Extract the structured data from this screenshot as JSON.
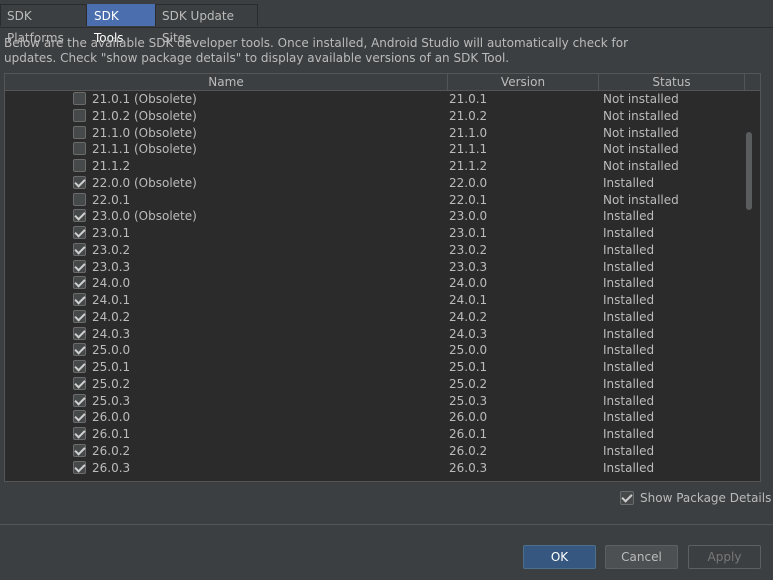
{
  "tabs": [
    {
      "label": "SDK Platforms"
    },
    {
      "label": "SDK Tools"
    },
    {
      "label": "SDK Update Sites"
    }
  ],
  "description_line1": "Below are the available SDK developer tools. Once installed, Android Studio will automatically check for",
  "description_line2": "updates. Check \"show package details\" to display available versions of an SDK Tool.",
  "table": {
    "columns": {
      "name": "Name",
      "version": "Version",
      "status": "Status"
    },
    "rows": [
      {
        "name": "21.0.1 (Obsolete)",
        "version": "21.0.1",
        "status": "Not installed",
        "checked": false
      },
      {
        "name": "21.0.2 (Obsolete)",
        "version": "21.0.2",
        "status": "Not installed",
        "checked": false
      },
      {
        "name": "21.1.0 (Obsolete)",
        "version": "21.1.0",
        "status": "Not installed",
        "checked": false
      },
      {
        "name": "21.1.1 (Obsolete)",
        "version": "21.1.1",
        "status": "Not installed",
        "checked": false
      },
      {
        "name": "21.1.2",
        "version": "21.1.2",
        "status": "Not installed",
        "checked": false
      },
      {
        "name": "22.0.0 (Obsolete)",
        "version": "22.0.0",
        "status": "Installed",
        "checked": true
      },
      {
        "name": "22.0.1",
        "version": "22.0.1",
        "status": "Not installed",
        "checked": false
      },
      {
        "name": "23.0.0 (Obsolete)",
        "version": "23.0.0",
        "status": "Installed",
        "checked": true
      },
      {
        "name": "23.0.1",
        "version": "23.0.1",
        "status": "Installed",
        "checked": true
      },
      {
        "name": "23.0.2",
        "version": "23.0.2",
        "status": "Installed",
        "checked": true
      },
      {
        "name": "23.0.3",
        "version": "23.0.3",
        "status": "Installed",
        "checked": true
      },
      {
        "name": "24.0.0",
        "version": "24.0.0",
        "status": "Installed",
        "checked": true
      },
      {
        "name": "24.0.1",
        "version": "24.0.1",
        "status": "Installed",
        "checked": true
      },
      {
        "name": "24.0.2",
        "version": "24.0.2",
        "status": "Installed",
        "checked": true
      },
      {
        "name": "24.0.3",
        "version": "24.0.3",
        "status": "Installed",
        "checked": true
      },
      {
        "name": "25.0.0",
        "version": "25.0.0",
        "status": "Installed",
        "checked": true
      },
      {
        "name": "25.0.1",
        "version": "25.0.1",
        "status": "Installed",
        "checked": true
      },
      {
        "name": "25.0.2",
        "version": "25.0.2",
        "status": "Installed",
        "checked": true
      },
      {
        "name": "25.0.3",
        "version": "25.0.3",
        "status": "Installed",
        "checked": true
      },
      {
        "name": "26.0.0",
        "version": "26.0.0",
        "status": "Installed",
        "checked": true
      },
      {
        "name": "26.0.1",
        "version": "26.0.1",
        "status": "Installed",
        "checked": true
      },
      {
        "name": "26.0.2",
        "version": "26.0.2",
        "status": "Installed",
        "checked": true
      },
      {
        "name": "26.0.3",
        "version": "26.0.3",
        "status": "Installed",
        "checked": true
      }
    ]
  },
  "show_package_details": {
    "label": "Show Package Details",
    "checked": true
  },
  "buttons": {
    "ok": "OK",
    "cancel": "Cancel",
    "apply": "Apply"
  }
}
